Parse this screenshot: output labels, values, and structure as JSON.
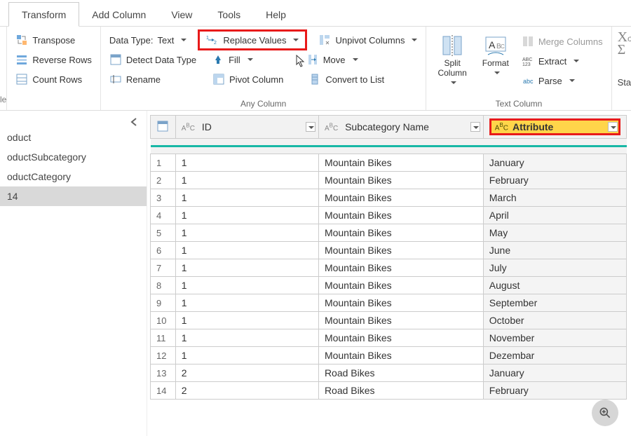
{
  "tabs": {
    "items": [
      "Transform",
      "Add Column",
      "View",
      "Tools",
      "Help"
    ],
    "active_index": 0
  },
  "ribbon": {
    "leftedge_label": "le",
    "group_table": {
      "transpose": "Transpose",
      "reverse_rows": "Reverse Rows",
      "count_rows": "Count Rows"
    },
    "group_anycolumn": {
      "label": "Any Column",
      "data_type_prefix": "Data Type: ",
      "data_type_value": "Text",
      "detect": "Detect Data Type",
      "rename": "Rename",
      "replace_values": "Replace Values",
      "fill": "Fill",
      "pivot": "Pivot Column",
      "unpivot": "Unpivot Columns",
      "move": "Move",
      "convert_to_list": "Convert to List"
    },
    "group_textcolumn": {
      "label": "Text Column",
      "split": "Split\nColumn",
      "format": "Format",
      "merge": "Merge Columns",
      "extract": "Extract",
      "parse": "Parse"
    },
    "group_stats": {
      "label": "Statis"
    }
  },
  "sidebar": {
    "items": [
      "oduct",
      "oductSubcategory",
      "oductCategory",
      "14"
    ],
    "selected_index": 3
  },
  "grid": {
    "type_badge": "ABC",
    "columns": [
      "ID",
      "Subcategory Name",
      "Attribute"
    ],
    "selected_column_index": 2,
    "rows": [
      {
        "n": 1,
        "id": "1",
        "sub": "Mountain Bikes",
        "attr": "January"
      },
      {
        "n": 2,
        "id": "1",
        "sub": "Mountain Bikes",
        "attr": "February"
      },
      {
        "n": 3,
        "id": "1",
        "sub": "Mountain Bikes",
        "attr": "March"
      },
      {
        "n": 4,
        "id": "1",
        "sub": "Mountain Bikes",
        "attr": "April"
      },
      {
        "n": 5,
        "id": "1",
        "sub": "Mountain Bikes",
        "attr": "May"
      },
      {
        "n": 6,
        "id": "1",
        "sub": "Mountain Bikes",
        "attr": "June"
      },
      {
        "n": 7,
        "id": "1",
        "sub": "Mountain Bikes",
        "attr": "July"
      },
      {
        "n": 8,
        "id": "1",
        "sub": "Mountain Bikes",
        "attr": "August"
      },
      {
        "n": 9,
        "id": "1",
        "sub": "Mountain Bikes",
        "attr": "September"
      },
      {
        "n": 10,
        "id": "1",
        "sub": "Mountain Bikes",
        "attr": "October"
      },
      {
        "n": 11,
        "id": "1",
        "sub": "Mountain Bikes",
        "attr": "November"
      },
      {
        "n": 12,
        "id": "1",
        "sub": "Mountain Bikes",
        "attr": "Dezembar"
      },
      {
        "n": 13,
        "id": "2",
        "sub": "Road Bikes",
        "attr": "January"
      },
      {
        "n": 14,
        "id": "2",
        "sub": "Road Bikes",
        "attr": "February"
      }
    ]
  },
  "icons": {
    "sigma": "Σ",
    "xo": "Χσ"
  }
}
